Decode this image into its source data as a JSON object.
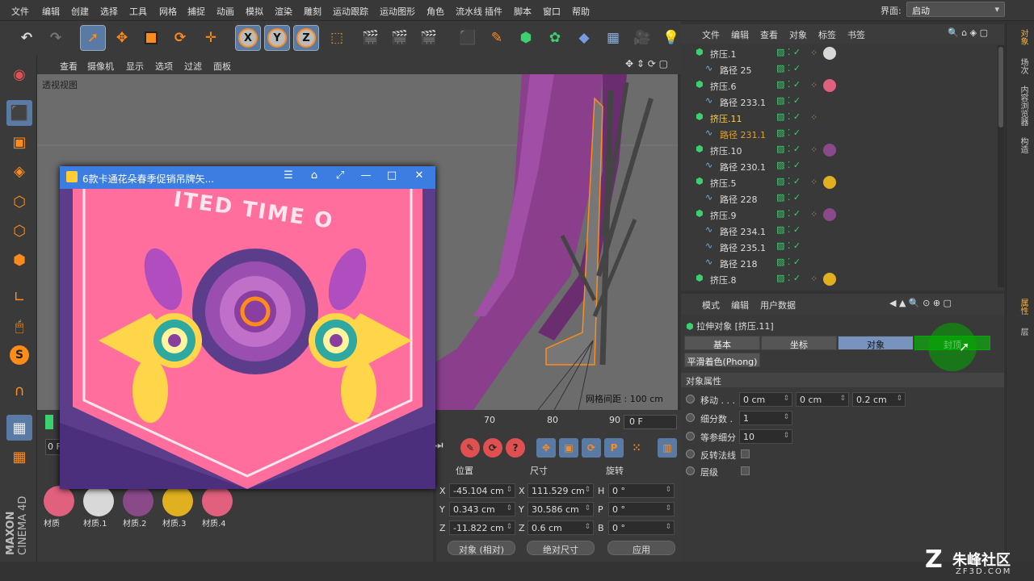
{
  "menubar": {
    "items": [
      "文件",
      "编辑",
      "创建",
      "选择",
      "工具",
      "网格",
      "捕捉",
      "动画",
      "模拟",
      "渲染",
      "雕刻",
      "运动跟踪",
      "运动图形",
      "角色",
      "流水线",
      "插件",
      "脚本",
      "窗口",
      "帮助"
    ],
    "layout_label": "界面:",
    "layout_value": "启动"
  },
  "toolbar": {
    "icons": [
      "undo-icon",
      "redo-icon",
      "select-icon",
      "move-icon",
      "scale-icon",
      "rotate-icon",
      "live-select-icon",
      "x-axis-icon",
      "y-axis-icon",
      "z-axis-icon",
      "coord-system-icon",
      "render-view-icon",
      "render-picture-icon",
      "render-settings-icon",
      "cube-icon",
      "pen-icon",
      "subdivision-icon",
      "cloner-icon",
      "deformer-icon",
      "floor-icon",
      "camera-icon",
      "light-icon"
    ],
    "axis_x": "X",
    "axis_y": "Y",
    "axis_z": "Z"
  },
  "viewport": {
    "menu": [
      "查看",
      "摄像机",
      "显示",
      "选项",
      "过滤",
      "面板"
    ],
    "label": "透视视图",
    "grid_spacing": "网格间距 : 100 cm"
  },
  "timeline": {
    "ticks": [
      "70",
      "80",
      "90"
    ],
    "frame": "0 F",
    "left_frame": "0 F"
  },
  "materials": [
    {
      "name": "材质",
      "color": "#e0607e"
    },
    {
      "name": "材质.1",
      "color": "#d8d8d8"
    },
    {
      "name": "材质.2",
      "color": "#8a4a8a"
    },
    {
      "name": "材质.3",
      "color": "#e0b020"
    },
    {
      "name": "材质.4",
      "color": "#e0607e"
    }
  ],
  "coords": {
    "headers": {
      "pos": "位置",
      "size": "尺寸",
      "rot": "旋转"
    },
    "x": {
      "label": "X",
      "pos": "-45.104 cm",
      "size_label": "X",
      "size": "111.529 cm",
      "rot_label": "H",
      "rot": "0 °"
    },
    "y": {
      "label": "Y",
      "pos": "0.343 cm",
      "size_label": "Y",
      "size": "30.586 cm",
      "rot_label": "P",
      "rot": "0 °"
    },
    "z": {
      "label": "Z",
      "pos": "-11.822 cm",
      "size_label": "Z",
      "size": "0.6 cm",
      "rot_label": "B",
      "rot": "0 °"
    },
    "mode": "对象 (相对)",
    "size_mode": "绝对尺寸",
    "apply": "应用"
  },
  "objects": {
    "menu": [
      "文件",
      "编辑",
      "查看",
      "对象",
      "标签",
      "书签"
    ],
    "rows": [
      {
        "name": "挤压.1",
        "type": "extrude",
        "tag": "#d8d8d8"
      },
      {
        "name": "路径 25",
        "type": "spline",
        "tag": ""
      },
      {
        "name": "挤压.6",
        "type": "extrude",
        "tag": "#e0607e"
      },
      {
        "name": "路径 233.1",
        "type": "spline",
        "tag": ""
      },
      {
        "name": "挤压.11",
        "type": "extrude",
        "tag": "",
        "active": true
      },
      {
        "name": "路径 231.1",
        "type": "spline",
        "tag": "",
        "active2": true
      },
      {
        "name": "挤压.10",
        "type": "extrude",
        "tag": "#8a4a8a"
      },
      {
        "name": "路径 230.1",
        "type": "spline",
        "tag": ""
      },
      {
        "name": "挤压.5",
        "type": "extrude",
        "tag": "#e0b020"
      },
      {
        "name": "路径 228",
        "type": "spline",
        "tag": ""
      },
      {
        "name": "挤压.9",
        "type": "extrude",
        "tag": "#8a4a8a"
      },
      {
        "name": "路径 234.1",
        "type": "spline",
        "tag": ""
      },
      {
        "name": "路径 235.1",
        "type": "spline",
        "tag": ""
      },
      {
        "name": "路径 218",
        "type": "spline",
        "tag": ""
      },
      {
        "name": "挤压.8",
        "type": "extrude",
        "tag": "#e0b020"
      }
    ]
  },
  "attributes": {
    "menu": [
      "模式",
      "编辑",
      "用户数据"
    ],
    "title": "拉伸对象 [挤压.11]",
    "tabs": [
      "基本",
      "坐标",
      "对象",
      "封顶"
    ],
    "active_tab": "对象",
    "phong_tab": "平滑着色(Phong)",
    "section": "对象属性",
    "move_label": "移动 . . .",
    "move_x": "0 cm",
    "move_y": "0 cm",
    "move_z": "0.2 cm",
    "subdiv_label": "细分数 .",
    "subdiv": "1",
    "iso_label": "等参细分",
    "iso": "10",
    "flip_label": "反转法线",
    "hier_label": "层级"
  },
  "right_tabs": [
    "对象",
    "场次",
    "内容浏览器",
    "构造",
    "属性",
    "层"
  ],
  "float_window": {
    "title": "6款卡通花朵春季促销吊牌矢...",
    "banner_text": "ITED TIME O"
  },
  "branding": {
    "cinema": "CINEMA 4D",
    "maxon": "MAXON"
  },
  "watermark": {
    "main": "朱峰社区",
    "sub": "ZF3D.COM"
  }
}
